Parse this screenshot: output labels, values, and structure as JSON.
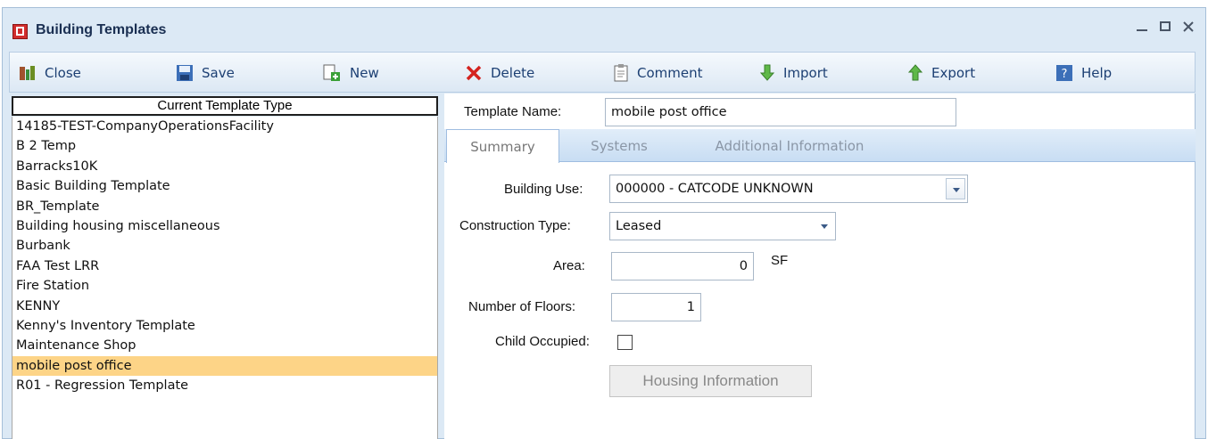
{
  "window": {
    "title": "Building Templates"
  },
  "toolbar": [
    {
      "label": "Close",
      "icon": "close-icon"
    },
    {
      "label": "Save",
      "icon": "save-icon"
    },
    {
      "label": "New",
      "icon": "new-icon"
    },
    {
      "label": "Delete",
      "icon": "delete-icon"
    },
    {
      "label": "Comment",
      "icon": "comment-icon"
    },
    {
      "label": "Import",
      "icon": "import-icon"
    },
    {
      "label": "Export",
      "icon": "export-icon"
    },
    {
      "label": "Help",
      "icon": "help-icon"
    }
  ],
  "template_list": {
    "header": "Current Template Type",
    "items": [
      "14185-TEST-CompanyOperationsFacility",
      "B 2 Temp",
      "Barracks10K",
      "Basic Building Template",
      "BR_Template",
      "Building housing miscellaneous",
      "Burbank",
      "FAA Test LRR",
      "Fire Station",
      "KENNY",
      "Kenny's Inventory Template",
      "Maintenance Shop",
      "mobile post office",
      "R01 - Regression Template"
    ],
    "selected": "mobile post office"
  },
  "form": {
    "template_name_label": "Template Name:",
    "template_name_value": "mobile post office",
    "tabs": [
      "Summary",
      "Systems",
      "Additional Information"
    ],
    "active_tab": "Summary",
    "building_use_label": "Building Use:",
    "building_use_value": "000000 - CATCODE UNKNOWN",
    "construction_type_label": "Construction Type:",
    "construction_type_value": "Leased",
    "area_label": "Area:",
    "area_value": "0",
    "area_unit": "SF",
    "floors_label": "Number of Floors:",
    "floors_value": "1",
    "child_occupied_label": "Child Occupied:",
    "child_occupied_checked": false,
    "housing_button": "Housing Information"
  },
  "colors": {
    "selected_row": "#fdd487",
    "tabbar": "#c8ddf3",
    "title_text": "#1a2f52",
    "toolbar_text": "#1c3f73"
  }
}
